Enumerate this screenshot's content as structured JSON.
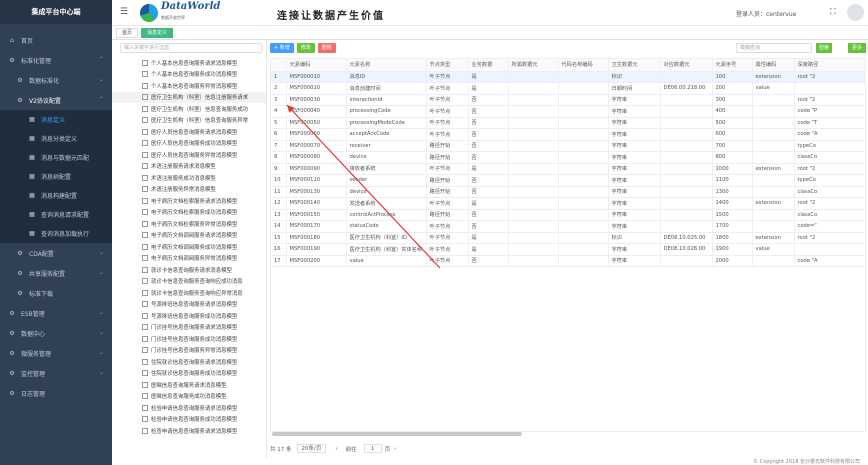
{
  "sidebar": {
    "brand": "集成平台中心端",
    "items": [
      {
        "label": "首页",
        "icon": "home-icon"
      },
      {
        "label": "标准化管理",
        "icon": "gear-icon"
      },
      {
        "label": "数据标准化",
        "icon": "gear-icon"
      },
      {
        "label": "V2协议配置",
        "icon": "gear-icon"
      },
      {
        "label": "消息定义",
        "icon": "grid-icon"
      },
      {
        "label": "消息分类定义",
        "icon": "grid-icon"
      },
      {
        "label": "消息与数据元匹配",
        "icon": "grid-icon"
      },
      {
        "label": "消息树配置",
        "icon": "grid-icon"
      },
      {
        "label": "消息构建配置",
        "icon": "grid-icon"
      },
      {
        "label": "查询消息请求配置",
        "icon": "grid-icon"
      },
      {
        "label": "查询消息加载执行",
        "icon": "grid-icon"
      },
      {
        "label": "CDA配置",
        "icon": "gear-icon"
      },
      {
        "label": "共享服务配置",
        "icon": "gear-icon"
      },
      {
        "label": "标准下载",
        "icon": "gear-icon"
      },
      {
        "label": "ESB管理",
        "icon": "gear-icon"
      },
      {
        "label": "数据中心",
        "icon": "gear-icon"
      },
      {
        "label": "微服务管理",
        "icon": "gear-icon"
      },
      {
        "label": "监控管理",
        "icon": "gear-icon"
      },
      {
        "label": "日志管理",
        "icon": "gear-icon"
      }
    ]
  },
  "header": {
    "logo_text": "DataWorld",
    "logo_sub": "数据开放世界",
    "slogan": "连接让数据产生价值",
    "user": "登录人员：centervue"
  },
  "tags": [
    "首页",
    "消息定义"
  ],
  "tree": {
    "search_placeholder": "输入关键字进行过滤",
    "nodes": [
      "个人基本信息查询服务请求消息模型",
      "个人基本信息查询服务成功消息模型",
      "个人基本信息查询服务异常消息模型",
      "医疗卫生机构（科室）信息注册服务请求",
      "医疗卫生机构（科室）信息查询服务成功",
      "医疗卫生机构（科室）信息查询服务异常",
      "医疗人员信息查询服务请求消息模型",
      "医疗人员信息查询服务成功消息模型",
      "医疗人员信息查询服务异常消息模型",
      "术语注册服务请求消息模型",
      "术语注册服务成功消息模型",
      "术语注册服务异常消息模型",
      "电子病历文档检索服务请求消息模型",
      "电子病历文档检索服务成功消息模型",
      "电子病历文档检索服务异常消息模型",
      "电子病历文档调阅服务请求消息模型",
      "电子病历文档调阅服务成功消息模型",
      "电子病历文档调阅服务异常消息模型",
      "就诊卡信息查询服务请求消息模型",
      "就诊卡信息查询服务查询响应成功消息",
      "就诊卡信息查询服务查询响应异常消息",
      "号源排班信息查询服务请求消息模型",
      "号源排班信息查询服务成功消息模型",
      "门诊挂号信息查询服务请求消息模型",
      "门诊挂号信息查询服务成功消息模型",
      "门诊挂号信息查询服务异常消息模型",
      "住院就诊信息查询服务请求消息模型",
      "住院就诊信息查询服务成功消息模型",
      "医嘱信息查询服务请求消息模型",
      "医嘱信息查询服务成功消息模型",
      "检验申请信息查询服务请求消息模型",
      "检验申请信息查询服务成功消息模型",
      "检查申请信息查询服务请求消息模型"
    ]
  },
  "toolbar": {
    "add": "+ 新增",
    "edit": "修改",
    "delete": "删除",
    "search_placeholder": "模糊查询",
    "search": "检索",
    "more": "更多"
  },
  "table": {
    "columns": [
      "",
      "元素编码",
      "元素名称",
      "节点类型",
      "业务数据",
      "所属数据元",
      "代码名称编码",
      "卫生数据元",
      "对应数据元",
      "元素序号",
      "属性编码",
      "深度路径"
    ],
    "rows": [
      [
        "1",
        "MSF000010",
        "消息ID",
        "叶子节点",
        "是",
        "",
        "",
        "标识",
        "",
        "100",
        "extension",
        "root \"2"
      ],
      [
        "2",
        "MSF000020",
        "消息创建时间",
        "叶子节点",
        "是",
        "",
        "",
        "日期时间",
        "DE06.00.218.00",
        "200",
        "value",
        ""
      ],
      [
        "3",
        "MSF000030",
        "interactionId",
        "叶子节点",
        "否",
        "",
        "",
        "字符串",
        "",
        "300",
        "",
        "root \"2"
      ],
      [
        "4",
        "MSF000040",
        "processingCode",
        "叶子节点",
        "否",
        "",
        "",
        "字符串",
        "",
        "400",
        "",
        "code \"P"
      ],
      [
        "5",
        "MSF000050",
        "processingModeCode",
        "叶子节点",
        "否",
        "",
        "",
        "字符串",
        "",
        "500",
        "",
        "code \"T"
      ],
      [
        "6",
        "MSF000060",
        "acceptAckCode",
        "叶子节点",
        "否",
        "",
        "",
        "字符串",
        "",
        "600",
        "",
        "code \"A"
      ],
      [
        "7",
        "MSF000070",
        "receiver",
        "路径开始",
        "否",
        "",
        "",
        "字符串",
        "",
        "700",
        "",
        "typeCo"
      ],
      [
        "8",
        "MSF000080",
        "device",
        "路径开始",
        "否",
        "",
        "",
        "字符串",
        "",
        "800",
        "",
        "classCo"
      ],
      [
        "9",
        "MSF000090",
        "接收者系统",
        "叶子节点",
        "是",
        "",
        "",
        "字符串",
        "",
        "1000",
        "extension",
        "root \"2"
      ],
      [
        "10",
        "MSF000110",
        "sender",
        "路径开始",
        "否",
        "",
        "",
        "字符串",
        "",
        "1100",
        "",
        "typeCo"
      ],
      [
        "11",
        "MSF000130",
        "device",
        "路径开始",
        "否",
        "",
        "",
        "字符串",
        "",
        "1300",
        "",
        "classCo"
      ],
      [
        "12",
        "MSF000140",
        "发送者系统",
        "叶子节点",
        "是",
        "",
        "",
        "字符串",
        "",
        "1400",
        "extension",
        "root \"2"
      ],
      [
        "13",
        "MSF000150",
        "controlActProcess",
        "路径开始",
        "否",
        "",
        "",
        "字符串",
        "",
        "1500",
        "",
        "classCo"
      ],
      [
        "14",
        "MSF000170",
        "statusCode",
        "叶子节点",
        "否",
        "",
        "",
        "字符串",
        "",
        "1700",
        "",
        "code=\""
      ],
      [
        "15",
        "MSF000180",
        "医疗卫生机构（科室）ID",
        "叶子节点",
        "是",
        "",
        "",
        "标识",
        "DE08.10.025.00",
        "1800",
        "extension",
        "root \"2"
      ],
      [
        "16",
        "MSF000190",
        "医疗卫生机构（科室）实体名称",
        "叶子节点",
        "是",
        "",
        "",
        "字符串",
        "DE08.10.026.00",
        "1900",
        "value",
        ""
      ],
      [
        "17",
        "MSF000200",
        "value",
        "叶子节点",
        "否",
        "",
        "",
        "字符串",
        "",
        "2000",
        "",
        "code \"A"
      ]
    ]
  },
  "pager": {
    "total": "共 17 条",
    "size": "20条/页",
    "prev": "‹",
    "prev_label": "前往",
    "page": "1",
    "page_suffix": "页",
    "next": "›"
  },
  "footer": "© Copyright 2018 长沙娄氏软件科技有限公司",
  "colors": {
    "sidebar": "#304156",
    "accent": "#409eff",
    "success": "#67c23a",
    "danger": "#f56c6c",
    "tag": "#42b983",
    "arrow": "#e53935"
  }
}
